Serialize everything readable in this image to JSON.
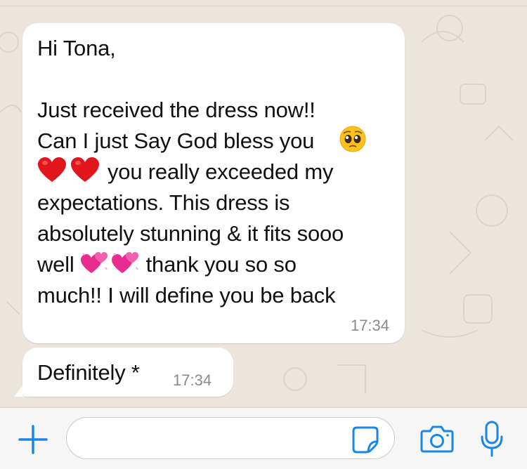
{
  "conversation": {
    "messages": [
      {
        "line1": "Hi Tona,",
        "line2": "Just received the dress now!!",
        "line3": "Can I just Say God bless you",
        "line4": "you really exceeded my",
        "line5": "expectations. This dress is",
        "line6": "absolutely stunning & it fits sooo",
        "line7_a": "well",
        "line7_b": "thank you so so",
        "line8": "much!! I will define you be back",
        "time": "17:34"
      },
      {
        "text": "Definitely *",
        "time": "17:34"
      }
    ]
  },
  "composer": {
    "message_value": ""
  },
  "icons": {
    "add": "plus-icon",
    "sticker": "sticker-icon",
    "camera": "camera-icon",
    "mic": "microphone-icon"
  },
  "colors": {
    "accent": "#1a87e8",
    "chat_background": "#ece5dd",
    "bubble": "#ffffff",
    "timestamp": "#8a8a8a"
  }
}
